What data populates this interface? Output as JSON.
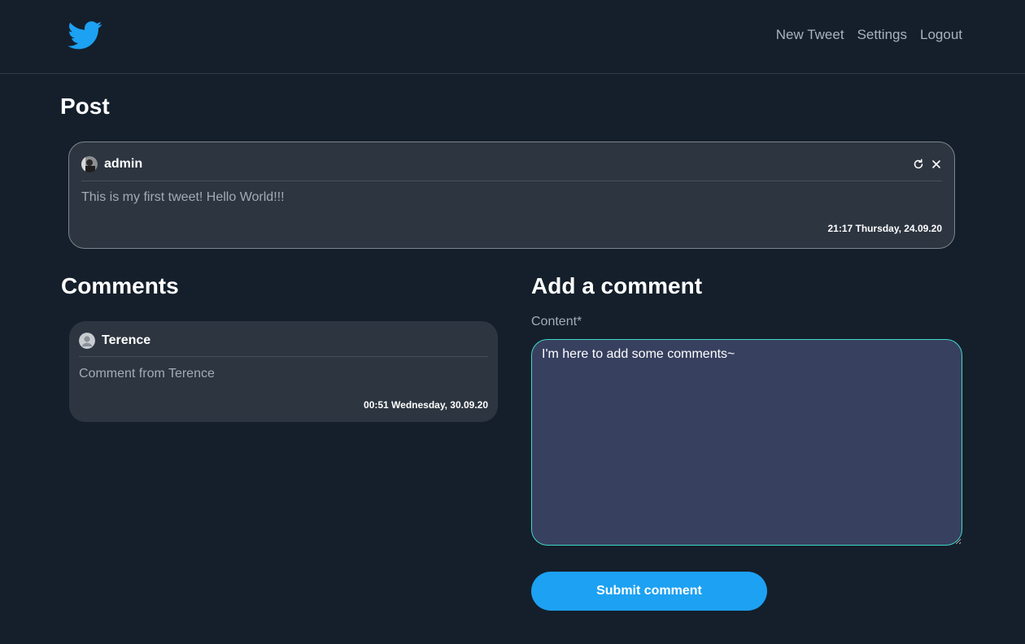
{
  "nav": {
    "logo": "twitter-bird-icon",
    "brand_color": "#1da1f2",
    "links": [
      "New Tweet",
      "Settings",
      "Logout"
    ]
  },
  "post_section": {
    "title": "Post",
    "post": {
      "author": "admin",
      "content": "This is my first tweet! Hello World!!!",
      "timestamp": "21:17 Thursday, 24.09.20",
      "actions": [
        "refresh-icon",
        "close-icon"
      ]
    }
  },
  "comments_section": {
    "title": "Comments",
    "comments": [
      {
        "author": "Terence",
        "content": "Comment from Terence",
        "timestamp": "00:51 Wednesday, 30.09.20"
      }
    ]
  },
  "add_comment": {
    "title": "Add a comment",
    "field_label": "Content*",
    "value": "I'm here to add some comments~",
    "submit_label": "Submit comment"
  }
}
